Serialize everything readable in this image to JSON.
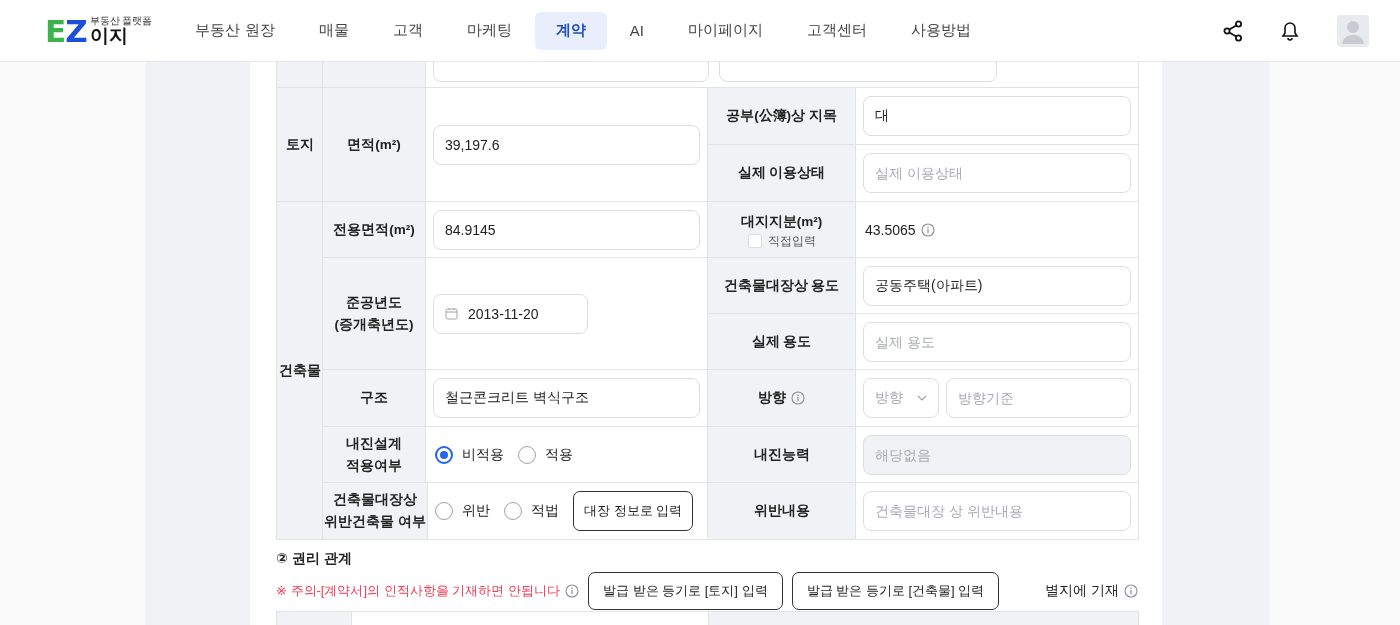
{
  "nav": {
    "logo": {
      "tagline": "부동산 플랫폼",
      "mark": "EZ",
      "word": "이지"
    },
    "items": [
      {
        "label": "부동산 원장",
        "selected": false
      },
      {
        "label": "매물",
        "selected": false
      },
      {
        "label": "고객",
        "selected": false
      },
      {
        "label": "마케팅",
        "selected": false
      },
      {
        "label": "계약",
        "selected": true
      },
      {
        "label": "AI",
        "selected": false
      },
      {
        "label": "마이페이지",
        "selected": false
      },
      {
        "label": "고객센터",
        "selected": false
      },
      {
        "label": "사용방법",
        "selected": false
      }
    ]
  },
  "sections": [
    {
      "label": "토지",
      "rows": [
        {
          "label": [
            "면적(m²)"
          ],
          "control": {
            "kind": "input",
            "value": "39,197.6"
          },
          "right": [
            {
              "label": [
                "공부(公簿)상 지목"
              ],
              "control": {
                "kind": "input",
                "value": "대"
              }
            },
            {
              "label": [
                "실제 이용상태"
              ],
              "control": {
                "kind": "input",
                "placeholder": "실제 이용상태"
              }
            }
          ]
        }
      ]
    },
    {
      "label": "건축물",
      "rows": [
        {
          "label": [
            "전용면적(m²)"
          ],
          "control": {
            "kind": "input",
            "value": "84.9145"
          },
          "right": [
            {
              "label": [
                "대지지분(m²)"
              ],
              "checkbox": {
                "label": "직접입력",
                "checked": false
              },
              "control": {
                "kind": "text",
                "value": "43.5065",
                "info": true
              }
            }
          ]
        },
        {
          "label": [
            "준공년도",
            "(증개축년도)"
          ],
          "control": {
            "kind": "date",
            "value": "2013-11-20"
          },
          "right": [
            {
              "label": [
                "건축물대장상 용도"
              ],
              "control": {
                "kind": "input",
                "value": "공동주택(아파트)"
              }
            },
            {
              "label": [
                "실제 용도"
              ],
              "control": {
                "kind": "input",
                "placeholder": "실제 용도"
              }
            }
          ]
        },
        {
          "label": [
            "구조"
          ],
          "control": {
            "kind": "input",
            "value": "철근콘크리트 벽식구조"
          },
          "right": [
            {
              "label": [
                "방향"
              ],
              "info": true,
              "control": {
                "kind": "select_pair",
                "select": "방향",
                "placeholder": "방향기준"
              }
            }
          ]
        },
        {
          "label": [
            "내진설계",
            "적용여부"
          ],
          "control": {
            "kind": "radios",
            "options": [
              {
                "label": "비적용",
                "selected": true
              },
              {
                "label": "적용",
                "selected": false
              }
            ]
          },
          "right": [
            {
              "label": [
                "내진능력"
              ],
              "control": {
                "kind": "input",
                "placeholder": "해당없음",
                "disabled": true
              }
            }
          ]
        },
        {
          "label": [
            "건축물대장상",
            "위반건축물 여부"
          ],
          "control": {
            "kind": "radios",
            "options": [
              {
                "label": "위반",
                "selected": false
              },
              {
                "label": "적법",
                "selected": false
              }
            ],
            "button": "대장 정보로 입력"
          },
          "right": [
            {
              "label": [
                "위반내용"
              ],
              "control": {
                "kind": "input",
                "placeholder": "건축물대장 상 위반내용"
              }
            }
          ]
        }
      ]
    }
  ],
  "rights": {
    "title": "② 권리 관계",
    "warning": "※ 주의-[계약서]의 인적사항을 기재하면 안됩니다",
    "buttons": [
      "발급 받은 등기로 [토지] 입력",
      "발급 받은 등기로 [건축물] 입력"
    ],
    "attach": "별지에 기재"
  }
}
